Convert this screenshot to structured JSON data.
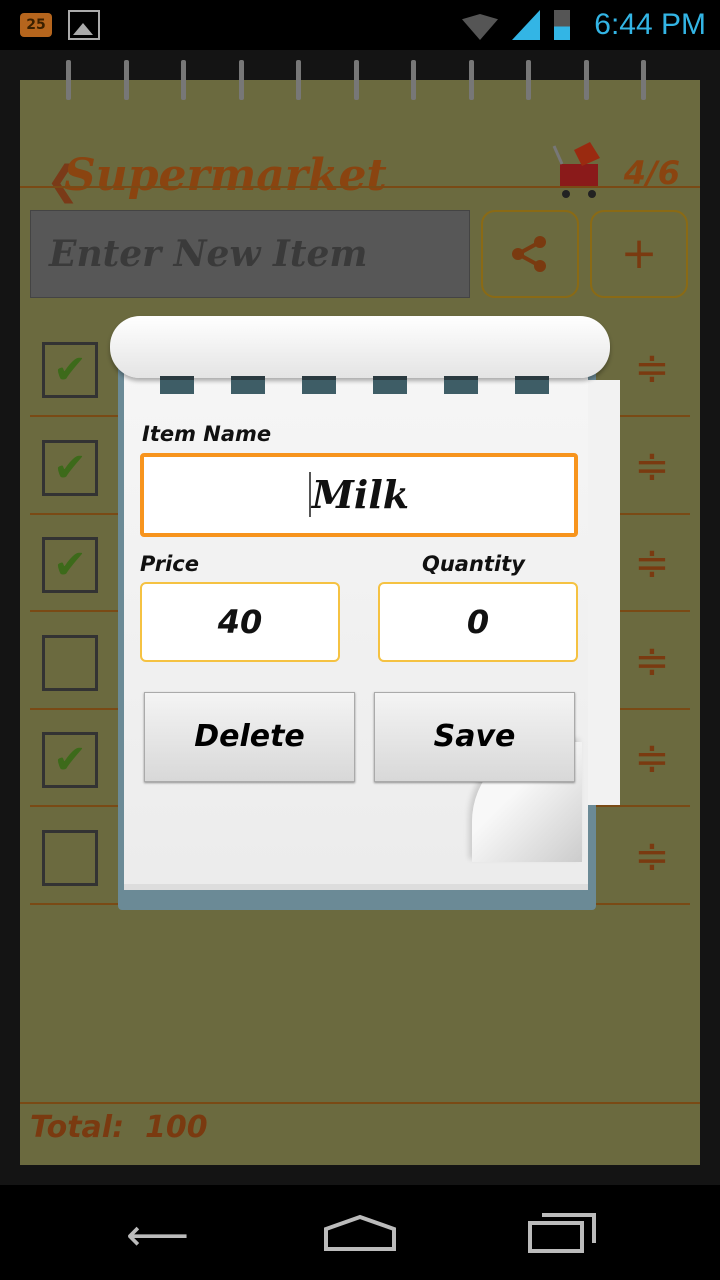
{
  "status_bar": {
    "time": "6:44 PM",
    "notification_count": "25",
    "icons": [
      "notification-badge-icon",
      "image-icon",
      "wifi-icon",
      "signal-e-icon",
      "battery-icon"
    ]
  },
  "header": {
    "title": "Supermarket",
    "progress": "4/6",
    "back_icon": "chevron-left-icon",
    "cart_icon": "shopping-cart-icon"
  },
  "new_item": {
    "placeholder": "Enter New Item",
    "share_icon": "share-icon",
    "add_label": "+"
  },
  "list": {
    "rows": [
      {
        "checked": true
      },
      {
        "checked": true
      },
      {
        "checked": true
      },
      {
        "checked": false
      },
      {
        "checked": true
      },
      {
        "checked": false
      }
    ],
    "handle_icon": "reorder-handle-icon"
  },
  "total": {
    "label": "Total:",
    "value": "100"
  },
  "dialog": {
    "item_name_label": "Item Name",
    "item_name_value": "Milk",
    "price_label": "Price",
    "price_value": "40",
    "quantity_label": "Quantity",
    "quantity_value": "0",
    "delete_label": "Delete",
    "save_label": "Save"
  },
  "colors": {
    "accent_orange": "#f7941d",
    "field_border": "#f5c242",
    "paper_dimmed": "#6b6a3f",
    "text_brown": "#8a4410"
  }
}
